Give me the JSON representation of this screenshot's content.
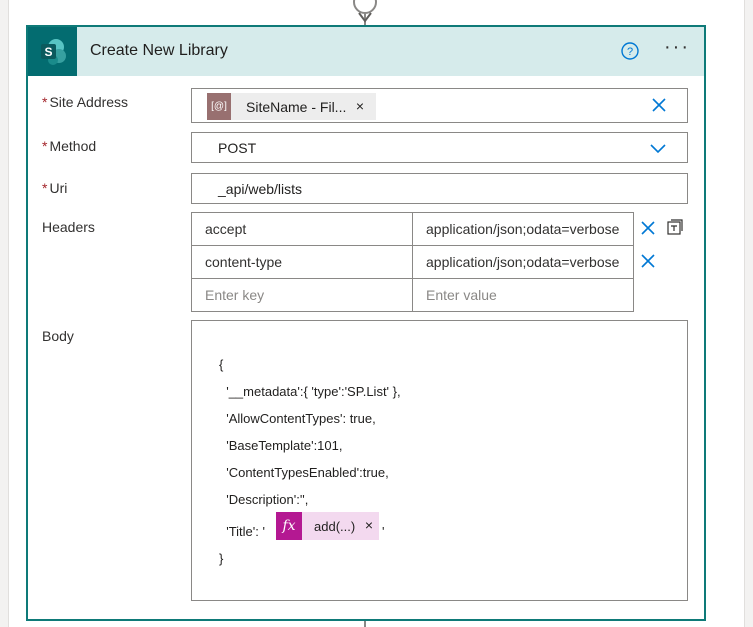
{
  "action": {
    "title": "Create New Library",
    "help_icon": "help-circle-icon",
    "more_icon": "more-ellipsis-icon",
    "more_label": "···"
  },
  "fields": {
    "required_mark": "*",
    "site_address": {
      "label": "Site Address",
      "token_icon_label": "[@]",
      "token_text": "SiteName - Fil...",
      "token_remove": "×"
    },
    "method": {
      "label": "Method",
      "value": "POST"
    },
    "uri": {
      "label": "Uri",
      "value": "_api/web/lists"
    },
    "headers": {
      "label": "Headers",
      "rows": [
        {
          "key": "accept",
          "value": "application/json;odata=verbose"
        },
        {
          "key": "content-type",
          "value": "application/json;odata=verbose"
        }
      ],
      "key_placeholder": "Enter key",
      "value_placeholder": "Enter value"
    },
    "body": {
      "label": "Body",
      "lines": [
        "{",
        "  '__metadata':{ 'type':'SP.List' },",
        "  'AllowContentTypes': true,",
        "  'BaseTemplate':101,",
        "  'ContentTypesEnabled':true,",
        "  'Description':'',",
        "  'Title': '",
        "}"
      ],
      "title_suffix": "'",
      "fx_icon_label": "fx",
      "fx_token_text": "add(...)",
      "fx_token_remove": "×"
    }
  },
  "colors": {
    "accent": "#0e7a78",
    "header_bg": "#d6ebeb",
    "sharepoint": "#036c70",
    "link_blue": "#0078d4",
    "required": "#a4262c",
    "fx_token": "#b41892"
  }
}
